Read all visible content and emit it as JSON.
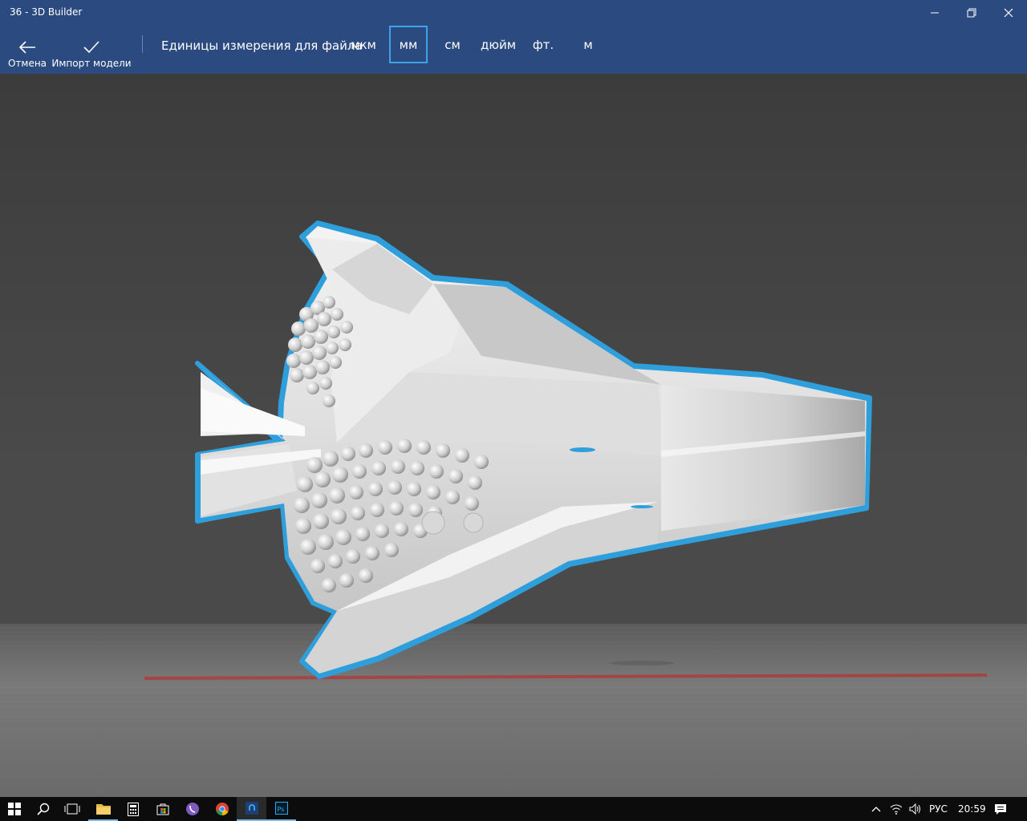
{
  "window": {
    "title": "36 - 3D Builder",
    "minimize_icon": "minimize-icon",
    "maximize_icon": "restore-icon",
    "close_icon": "close-icon"
  },
  "toolbar": {
    "cancel_label": "Отмена",
    "import_label": "Импорт модели",
    "units_label": "Единицы измерения для файла",
    "units": [
      "мкм",
      "мм",
      "см",
      "дюйм",
      "фт.",
      "м"
    ],
    "selected_unit": "мм"
  },
  "colors": {
    "accent": "#2b4a7f",
    "selection_outline": "#3ea2e6",
    "model": "#e6e6e6",
    "background": "#464646",
    "x_axis": "#c0392b"
  },
  "taskbar": {
    "apps": [
      "start-icon",
      "search-icon",
      "task-view-icon",
      "file-explorer-icon",
      "calculator-icon",
      "store-icon",
      "viber-icon",
      "chrome-icon",
      "3d-builder-icon",
      "photoshop-icon"
    ],
    "language": "РУС",
    "time": "20:59"
  }
}
